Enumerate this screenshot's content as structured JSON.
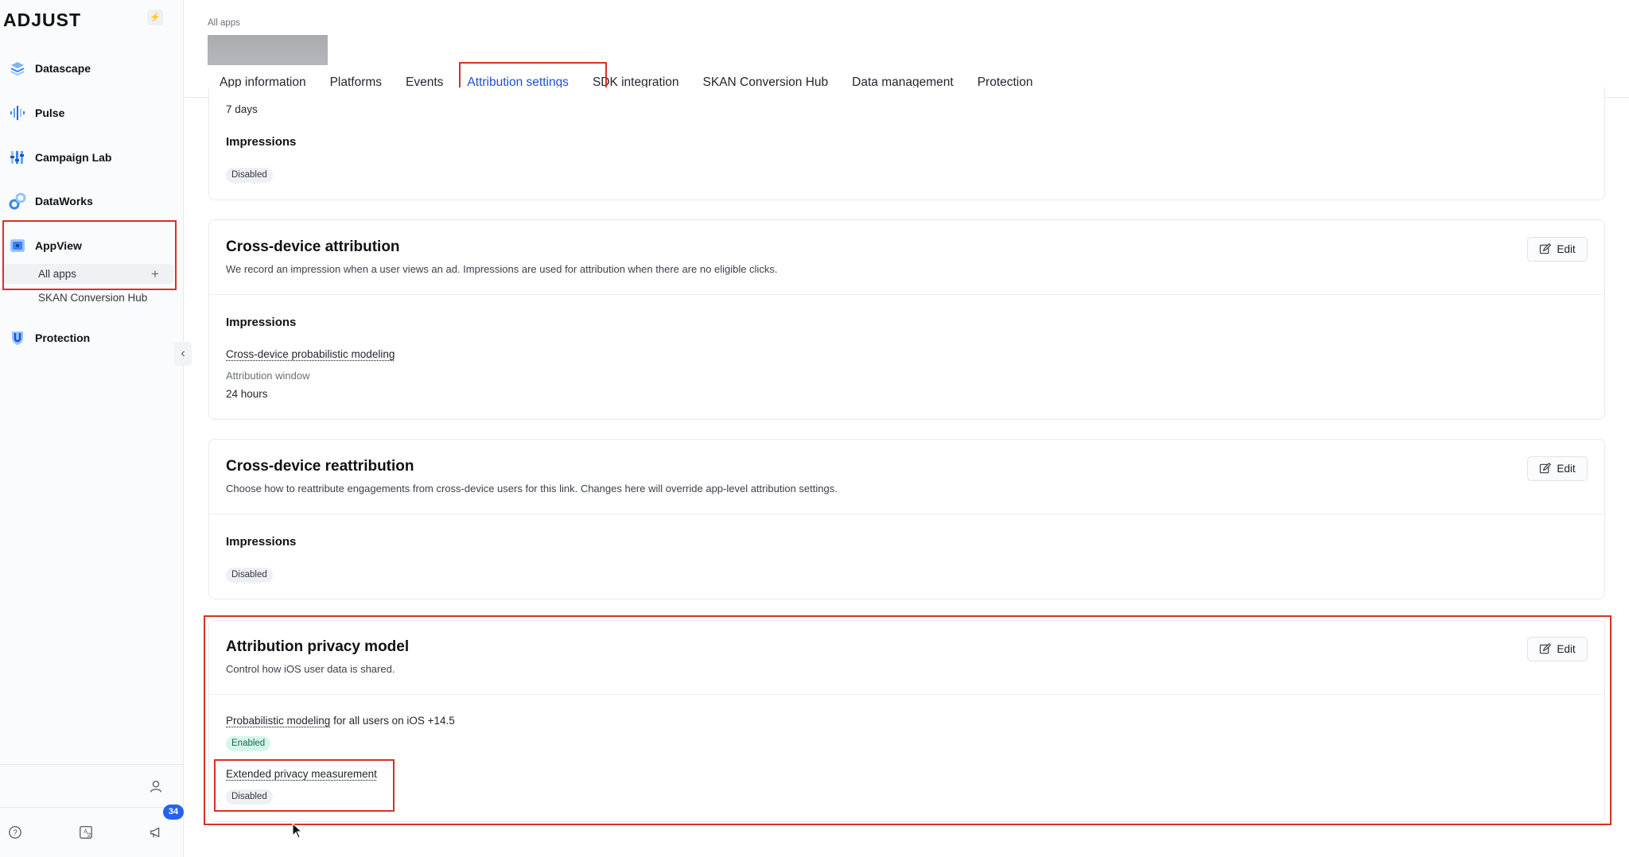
{
  "sidebar": {
    "logo": "ADJUST",
    "pin_icon": "bolt-icon",
    "items": [
      {
        "label": "Datascape",
        "icon": "datascape-icon"
      },
      {
        "label": "Pulse",
        "icon": "pulse-icon"
      },
      {
        "label": "Campaign Lab",
        "icon": "campaign-lab-icon"
      },
      {
        "label": "DataWorks",
        "icon": "dataworks-icon"
      },
      {
        "label": "AppView",
        "icon": "appview-icon"
      },
      {
        "label": "Protection",
        "icon": "protection-icon"
      }
    ],
    "sub_items": [
      "All apps",
      "SKAN Conversion Hub"
    ],
    "badge_count": "34"
  },
  "header": {
    "breadcrumb": "All apps",
    "tabs": [
      "App information",
      "Platforms",
      "Events",
      "Attribution settings",
      "SDK integration",
      "SKAN Conversion Hub",
      "Data management",
      "Protection"
    ],
    "active_tab": "Attribution settings"
  },
  "cards": {
    "partial": {
      "window_value": "7 days",
      "section": "Impressions",
      "status": "Disabled"
    },
    "cross_device_attribution": {
      "title": "Cross-device attribution",
      "description": "We record an impression when a user views an ad. Impressions are used for attribution when there are no eligible clicks.",
      "edit": "Edit",
      "section": "Impressions",
      "feature": "Cross-device probabilistic modeling",
      "window_label": "Attribution window",
      "window_value": "24 hours"
    },
    "cross_device_reattribution": {
      "title": "Cross-device reattribution",
      "description": "Choose how to reattribute engagements from cross-device users for this link. Changes here will override app-level attribution settings.",
      "edit": "Edit",
      "section": "Impressions",
      "status": "Disabled"
    },
    "privacy_model": {
      "title": "Attribution privacy model",
      "description": "Control how iOS user data is shared.",
      "edit": "Edit",
      "prob_link": "Probabilistic modeling",
      "prob_rest": " for all users on iOS +14.5",
      "prob_status": "Enabled",
      "extended_label": "Extended privacy measurement",
      "extended_status": "Disabled"
    }
  },
  "colors": {
    "accent": "#2563eb",
    "highlight": "#d93025",
    "enabled_bg": "#d8f5ec",
    "disabled_bg": "#eef0f3"
  }
}
